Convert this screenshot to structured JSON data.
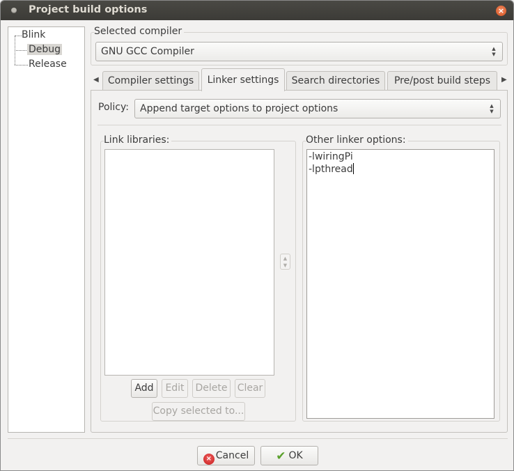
{
  "window": {
    "title": "Project build options"
  },
  "tree": {
    "root": "Blink",
    "children": [
      "Debug",
      "Release"
    ],
    "selected": "Debug"
  },
  "compiler": {
    "group_label": "Selected compiler",
    "value": "GNU GCC Compiler"
  },
  "tabs": [
    {
      "label": "Compiler settings"
    },
    {
      "label": "Linker settings"
    },
    {
      "label": "Search directories"
    },
    {
      "label": "Pre/post build steps"
    }
  ],
  "active_tab": "Linker settings",
  "policy": {
    "label": "Policy:",
    "value": "Append target options to project options"
  },
  "link_libraries": {
    "label": "Link libraries:",
    "items": [],
    "buttons": {
      "add": "Add",
      "edit": "Edit",
      "delete": "Delete",
      "clear": "Clear",
      "copy": "Copy selected to..."
    }
  },
  "other_linker": {
    "label": "Other linker options:",
    "lines": [
      "-lwiringPi",
      "-lpthread"
    ]
  },
  "dialog_buttons": {
    "cancel": "Cancel",
    "ok": "OK"
  },
  "colors": {
    "titlebar": "#3c3b37",
    "close_button": "#e0632e",
    "ok_check": "#5aa02c",
    "cancel_icon": "#d02020"
  }
}
